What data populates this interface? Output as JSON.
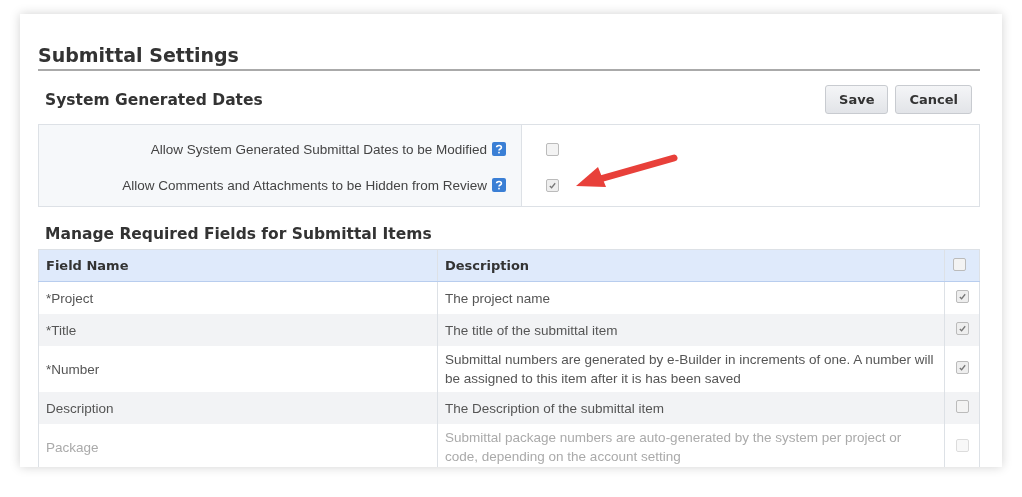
{
  "page_title": "Submittal Settings",
  "system_dates": {
    "heading": "System Generated Dates",
    "buttons": [
      "Save",
      "Cancel"
    ],
    "settings": [
      {
        "label": "Allow System Generated Submittal Dates to be Modified",
        "checked": false
      },
      {
        "label": "Allow Comments and Attachments to be Hidden from Review",
        "checked": true
      }
    ]
  },
  "required_fields": {
    "heading": "Manage Required Fields for Submittal Items",
    "columns": [
      "Field Name",
      "Description"
    ],
    "select_all_checked": false,
    "rows": [
      {
        "field": "*Project",
        "description": "The project name",
        "checked": true,
        "disabled": false
      },
      {
        "field": "*Title",
        "description": "The title of the submittal item",
        "checked": true,
        "disabled": false
      },
      {
        "field": "*Number",
        "description": "Submittal numbers are generated by e-Builder in increments of one. A number will be assigned to this item after it is has been saved",
        "checked": true,
        "disabled": false
      },
      {
        "field": "Description",
        "description": "The Description of the submittal item",
        "checked": false,
        "disabled": false
      },
      {
        "field": "Package",
        "description": "Submittal package numbers are auto-generated by the system per project or code, depending on the account setting",
        "checked": false,
        "disabled": true
      }
    ]
  }
}
